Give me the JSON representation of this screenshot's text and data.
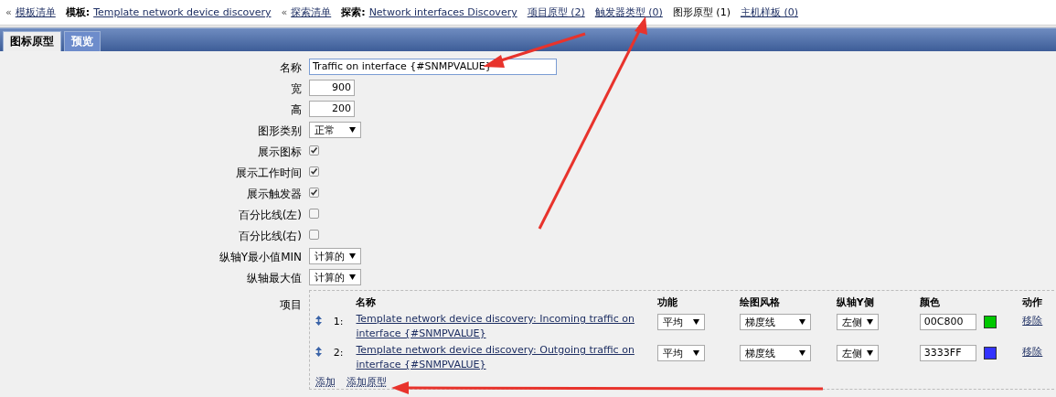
{
  "breadcrumbs": [
    {
      "kind": "back",
      "prefix": "«",
      "label": "模板清单"
    },
    {
      "kind": "labeled",
      "label": "模板:",
      "value": "Template network device discovery"
    },
    {
      "kind": "back",
      "prefix": "«",
      "label": "探索清单"
    },
    {
      "kind": "labeled",
      "label": "探索:",
      "value": "Network interfaces Discovery"
    },
    {
      "kind": "count",
      "label": "项目原型",
      "count": "(2)",
      "selected": false
    },
    {
      "kind": "count",
      "label": "触发器类型",
      "count": "(0)",
      "selected": false
    },
    {
      "kind": "count",
      "label": "图形原型",
      "count": "(1)",
      "selected": true
    },
    {
      "kind": "count",
      "label": "主机样板",
      "count": "(0)",
      "selected": false
    }
  ],
  "tabs": [
    {
      "label": "图标原型",
      "selected": true
    },
    {
      "label": "预览",
      "selected": false
    }
  ],
  "form": [
    {
      "kind": "text",
      "label": "名称",
      "value": "Traffic on interface {#SNMPVALUE}"
    },
    {
      "kind": "number",
      "label": "宽",
      "value": "900"
    },
    {
      "kind": "number",
      "label": "高",
      "value": "200"
    },
    {
      "kind": "select",
      "label": "图形类别",
      "value": "正常"
    },
    {
      "kind": "checkbox",
      "label": "展示图标",
      "checked": true
    },
    {
      "kind": "checkbox",
      "label": "展示工作时间",
      "checked": true
    },
    {
      "kind": "checkbox",
      "label": "展示触发器",
      "checked": true
    },
    {
      "kind": "checkbox",
      "label": "百分比线(左)",
      "checked": false
    },
    {
      "kind": "checkbox",
      "label": "百分比线(右)",
      "checked": false
    },
    {
      "kind": "select",
      "label": "纵轴Y最小值MIN",
      "value": "计算的"
    },
    {
      "kind": "select",
      "label": "纵轴最大值",
      "value": "计算的"
    },
    {
      "kind": "items",
      "label": "项目"
    }
  ],
  "items": {
    "columns": [
      "名称",
      "功能",
      "绘图风格",
      "纵轴Y侧",
      "颜色",
      "动作"
    ],
    "rows": [
      {
        "number": "1:",
        "name": "Template network device discovery: Incoming traffic on interface {#SNMPVALUE}",
        "function": "平均",
        "style": "梯度线",
        "axis": "左侧",
        "color_text": "00C800",
        "color": "#00c800",
        "action": "移除"
      },
      {
        "number": "2:",
        "name": "Template network device discovery: Outgoing traffic on interface {#SNMPVALUE}",
        "function": "平均",
        "style": "梯度线",
        "axis": "左侧",
        "color_text": "3333FF",
        "color": "#3333ff",
        "action": "移除"
      }
    ],
    "links": [
      "添加",
      "添加原型"
    ]
  }
}
